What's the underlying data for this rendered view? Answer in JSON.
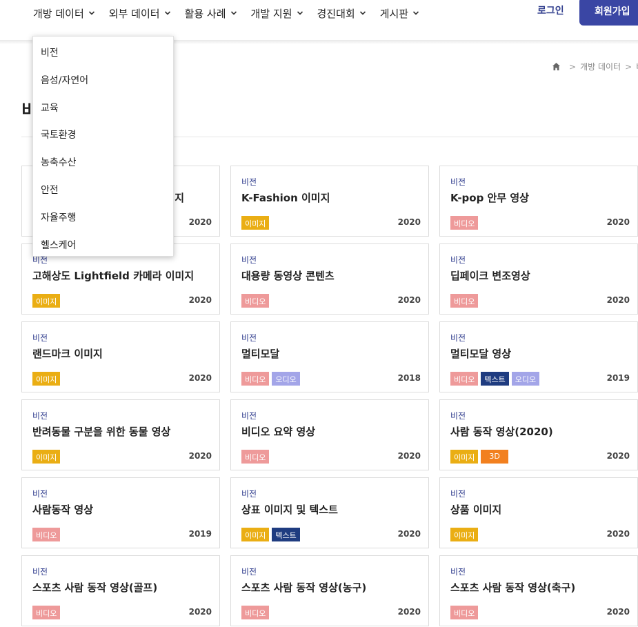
{
  "nav": {
    "items": [
      {
        "label": "개방 데이터"
      },
      {
        "label": "외부 데이터"
      },
      {
        "label": "활용 사례"
      },
      {
        "label": "개발 지원"
      },
      {
        "label": "경진대회"
      },
      {
        "label": "게시판"
      }
    ],
    "login_label": "로그인",
    "signup_label": "회원가입"
  },
  "breadcrumb": {
    "items": [
      "개방 데이터",
      "비"
    ]
  },
  "page": {
    "title": "비"
  },
  "dropdown": {
    "items": [
      "비전",
      "음성/자연어",
      "교육",
      "국토환경",
      "농축수산",
      "안전",
      "자율주행",
      "헬스케어"
    ]
  },
  "tag_colors": {
    "이미지": "#eaae14",
    "비디오": "#ee9a9a",
    "오디오": "#a3a5e8",
    "텍스트": "#1f3c80",
    "3D": "#f2801f"
  },
  "cards": [
    {
      "category": "비전",
      "title": "",
      "tags": [
        "이미지"
      ],
      "year": "2020",
      "title_suffix": "지"
    },
    {
      "category": "비전",
      "title": "K-Fashion 이미지",
      "tags": [
        "이미지"
      ],
      "year": "2020"
    },
    {
      "category": "비전",
      "title": "K-pop 안무 영상",
      "tags": [
        "비디오"
      ],
      "year": "2020"
    },
    {
      "category": "비전",
      "title": "고해상도 Lightfield 카메라 이미지",
      "tags": [
        "이미지"
      ],
      "year": "2020"
    },
    {
      "category": "비전",
      "title": "대용량 동영상 콘텐츠",
      "tags": [
        "비디오"
      ],
      "year": "2020"
    },
    {
      "category": "비전",
      "title": "딥페이크 변조영상",
      "tags": [
        "비디오"
      ],
      "year": "2020"
    },
    {
      "category": "비전",
      "title": "랜드마크 이미지",
      "tags": [
        "이미지"
      ],
      "year": "2020"
    },
    {
      "category": "비전",
      "title": "멀티모달",
      "tags": [
        "비디오",
        "오디오"
      ],
      "year": "2018"
    },
    {
      "category": "비전",
      "title": "멀티모달 영상",
      "tags": [
        "비디오",
        "텍스트",
        "오디오"
      ],
      "year": "2019"
    },
    {
      "category": "비전",
      "title": "반려동물 구분을 위한 동물 영상",
      "tags": [
        "이미지"
      ],
      "year": "2020"
    },
    {
      "category": "비전",
      "title": "비디오 요약 영상",
      "tags": [
        "비디오"
      ],
      "year": "2020"
    },
    {
      "category": "비전",
      "title": "사람 동작 영상(2020)",
      "tags": [
        "이미지",
        "3D"
      ],
      "year": "2020"
    },
    {
      "category": "비전",
      "title": "사람동작 영상",
      "tags": [
        "비디오"
      ],
      "year": "2019"
    },
    {
      "category": "비전",
      "title": "상표 이미지 및 텍스트",
      "tags": [
        "이미지",
        "텍스트"
      ],
      "year": "2020"
    },
    {
      "category": "비전",
      "title": "상품 이미지",
      "tags": [
        "이미지"
      ],
      "year": "2020"
    },
    {
      "category": "비전",
      "title": "스포츠 사람 동작 영상(골프)",
      "tags": [
        "비디오"
      ],
      "year": "2020"
    },
    {
      "category": "비전",
      "title": "스포츠 사람 동작 영상(농구)",
      "tags": [
        "비디오"
      ],
      "year": "2020"
    },
    {
      "category": "비전",
      "title": "스포츠 사람 동작 영상(축구)",
      "tags": [
        "비디오"
      ],
      "year": "2020"
    }
  ]
}
